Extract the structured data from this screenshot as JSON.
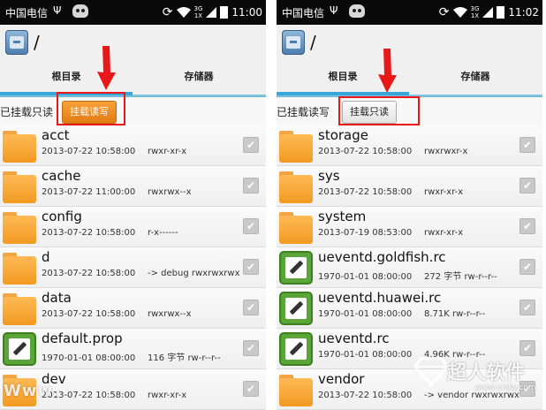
{
  "status_bar": {
    "carrier": "中国电信",
    "network_type": "3G",
    "network_speed": "1X",
    "time_left": "11:00",
    "time_right": "11:02"
  },
  "action_bar": {
    "path": "/"
  },
  "tabs": {
    "root": "根目录",
    "storage": "存储器"
  },
  "left": {
    "mount_status": "已挂载只读",
    "mount_button": "挂载读写",
    "files": [
      {
        "name": "acct",
        "date": "2013-07-22 10:58:00",
        "perm": "rwxr-xr-x",
        "type": "folder"
      },
      {
        "name": "cache",
        "date": "2013-07-22 11:00:00",
        "perm": "rwxrwx--x",
        "type": "folder"
      },
      {
        "name": "config",
        "date": "2013-07-22 10:58:00",
        "perm": "r-x------",
        "type": "folder"
      },
      {
        "name": "d",
        "date": "2013-07-22 10:58:00",
        "perm": "-> debug  rwxrwxrwx",
        "type": "folder"
      },
      {
        "name": "data",
        "date": "2013-07-22 10:58:00",
        "perm": "rwxrwx--x",
        "type": "folder"
      },
      {
        "name": "default.prop",
        "date": "1970-01-01 08:00:00",
        "perm": "116 字节  rw-r--r--",
        "type": "file"
      },
      {
        "name": "dev",
        "date": "2013-07-22 10:58:00",
        "perm": "rwxr-xr-x",
        "type": "folder"
      }
    ]
  },
  "right": {
    "mount_status": "已挂载读写",
    "mount_button": "挂载只读",
    "files": [
      {
        "name": "storage",
        "date": "2013-07-22 10:58:00",
        "perm": "rwxrwxr-x",
        "type": "folder"
      },
      {
        "name": "sys",
        "date": "2013-07-22 10:58:00",
        "perm": "rwxr-xr-x",
        "type": "folder"
      },
      {
        "name": "system",
        "date": "2013-07-19 08:53:00",
        "perm": "rwxr-xr-x",
        "type": "folder"
      },
      {
        "name": "ueventd.goldfish.rc",
        "date": "1970-01-01 08:00:00",
        "perm": "272 字节  rw-r--r--",
        "type": "file"
      },
      {
        "name": "ueventd.huawei.rc",
        "date": "1970-01-01 08:00:00",
        "perm": "8.71K  rw-r--r--",
        "type": "file"
      },
      {
        "name": "ueventd.rc",
        "date": "1970-01-01 08:00:00",
        "perm": "4.96K  rw-r--r--",
        "type": "file"
      },
      {
        "name": "vendor",
        "date": "2013-07-22 10:58:00",
        "perm": "-> vendor  rwxrwxrwx",
        "type": "folder"
      }
    ]
  },
  "watermark": {
    "left_text": "Www.",
    "right_text": "超人软件",
    "right_url": "www.crsky.com"
  },
  "icons": [
    "usb-icon",
    "cat-icon",
    "sync-icon",
    "wifi-icon",
    "signal-icon",
    "battery-icon",
    "app-icon",
    "folder-icon",
    "file-icon",
    "check-icon",
    "arrow-icon"
  ],
  "colors": {
    "accent": "#37a6d9",
    "highlight": "#e81818",
    "active_button": "#f29a21",
    "folder": "#f29a21",
    "file": "#5aa537"
  }
}
